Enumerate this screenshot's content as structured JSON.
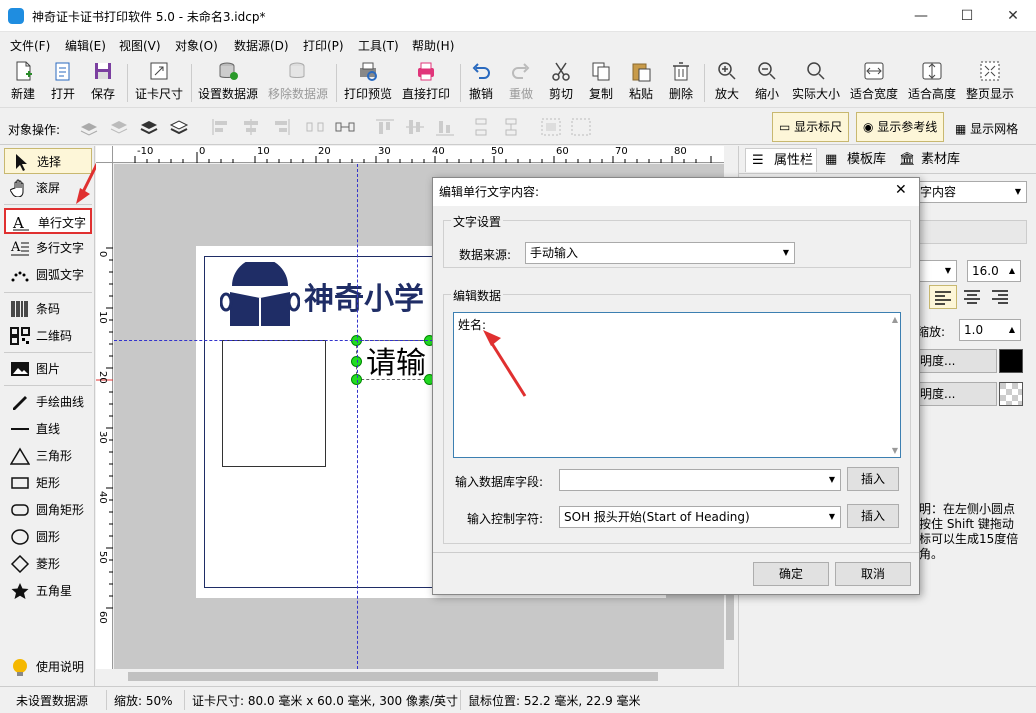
{
  "window": {
    "title": "神奇证卡证书打印软件 5.0 - 未命名3.idcp*",
    "min": "—",
    "max": "☐",
    "close": "✕"
  },
  "menu": [
    "文件(F)",
    "编辑(E)",
    "视图(V)",
    "对象(O)",
    "数据源(D)",
    "打印(P)",
    "工具(T)",
    "帮助(H)"
  ],
  "toolbar": [
    "新建",
    "打开",
    "保存",
    "证卡尺寸",
    "设置数据源",
    "移除数据源",
    "打印预览",
    "直接打印",
    "撤销",
    "重做",
    "剪切",
    "复制",
    "粘贴",
    "删除",
    "放大",
    "缩小",
    "实际大小",
    "适合宽度",
    "适合高度",
    "整页显示"
  ],
  "objbar": {
    "label": "对象操作:",
    "show_ruler": "显示标尺",
    "show_guides": "显示参考线",
    "show_grid": "显示网格"
  },
  "tools": [
    "选择",
    "滚屏",
    "单行文字",
    "多行文字",
    "圆弧文字",
    "条码",
    "二维码",
    "图片",
    "手绘曲线",
    "直线",
    "三角形",
    "矩形",
    "圆角矩形",
    "圆形",
    "菱形",
    "五角星",
    "使用说明"
  ],
  "ruler": {
    "h": [
      "-10",
      "0",
      "10",
      "20",
      "30",
      "40",
      "50",
      "60",
      "70",
      "80"
    ],
    "v": [
      "0",
      "10",
      "20",
      "30",
      "40",
      "50",
      "60"
    ]
  },
  "card": {
    "school": "神奇小学",
    "placeholder": "请输"
  },
  "right": {
    "tabs": [
      "属性栏",
      "模板库",
      "素材库"
    ],
    "content_combo": "字内容",
    "font_size": "16.0",
    "scale_label": "缩放:",
    "scale_value": "1.0",
    "color_btn1": "明度...",
    "color_btn2": "明度...",
    "tip": "明：在左侧小圆点\n按住 Shift 键拖动\n标可以生成15度倍\n角。",
    "partial": "字"
  },
  "dialog": {
    "title": "编辑单行文字内容:",
    "close": "✕",
    "text_settings": "文字设置",
    "source_label": "数据来源:",
    "source_value": "手动输入",
    "edit_data": "编辑数据",
    "text_value": "姓名:",
    "db_field_label": "输入数据库字段:",
    "db_field_value": "",
    "insert": "插入",
    "ctrl_label": "输入控制字符:",
    "ctrl_value": "SOH  报头开始(Start of Heading)",
    "ok": "确定",
    "cancel": "取消"
  },
  "status": {
    "datasource": "未设置数据源",
    "zoom": "缩放: 50%",
    "size": "证卡尺寸: 80.0 毫米 x 60.0 毫米, 300 像素/英寸",
    "mouse": "鼠标位置: 52.2 毫米, 22.9 毫米"
  },
  "colors": {
    "accent": "#1f2d66",
    "red": "#e03030",
    "handle": "#22dd22"
  }
}
